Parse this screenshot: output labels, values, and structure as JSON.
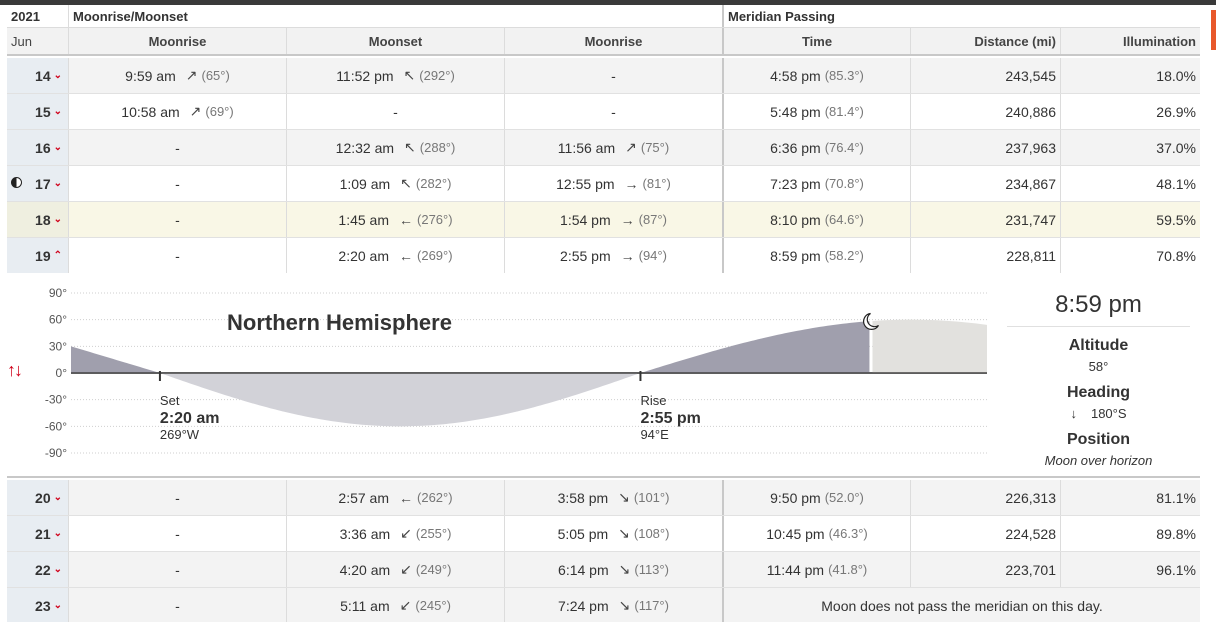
{
  "header": {
    "year": "2021",
    "group_rise_set": "Moonrise/Moonset",
    "group_meridian": "Meridian Passing",
    "month": "Jun",
    "col_moonrise_1": "Moonrise",
    "col_moonset": "Moonset",
    "col_moonrise_2": "Moonrise",
    "col_time": "Time",
    "col_distance": "Distance (mi)",
    "col_illumination": "Illumination"
  },
  "rows": [
    {
      "day": "14",
      "rise1": "9:59 am",
      "rise1_arrow": "↗",
      "rise1_deg": "(65°)",
      "set": "11:52 pm",
      "set_arrow": "↖",
      "set_deg": "(292°)",
      "rise2": "-",
      "rise2_arrow": "",
      "rise2_deg": "",
      "mer": "4:58 pm",
      "mer_deg": "(85.3°)",
      "dist": "243,545",
      "illum": "18.0%"
    },
    {
      "day": "15",
      "rise1": "10:58 am",
      "rise1_arrow": "↗",
      "rise1_deg": "(69°)",
      "set": "-",
      "set_arrow": "",
      "set_deg": "",
      "rise2": "-",
      "rise2_arrow": "",
      "rise2_deg": "",
      "mer": "5:48 pm",
      "mer_deg": "(81.4°)",
      "dist": "240,886",
      "illum": "26.9%"
    },
    {
      "day": "16",
      "rise1": "-",
      "rise1_arrow": "",
      "rise1_deg": "",
      "set": "12:32 am",
      "set_arrow": "↖",
      "set_deg": "(288°)",
      "rise2": "11:56 am",
      "rise2_arrow": "↗",
      "rise2_deg": "(75°)",
      "mer": "6:36 pm",
      "mer_deg": "(76.4°)",
      "dist": "237,963",
      "illum": "37.0%"
    },
    {
      "day": "17",
      "rise1": "-",
      "rise1_arrow": "",
      "rise1_deg": "",
      "set": "1:09 am",
      "set_arrow": "↖",
      "set_deg": "(282°)",
      "rise2": "12:55 pm",
      "rise2_arrow": "→",
      "rise2_deg": "(81°)",
      "mer": "7:23 pm",
      "mer_deg": "(70.8°)",
      "dist": "234,867",
      "illum": "48.1%"
    },
    {
      "day": "18",
      "rise1": "-",
      "rise1_arrow": "",
      "rise1_deg": "",
      "set": "1:45 am",
      "set_arrow": "←",
      "set_deg": "(276°)",
      "rise2": "1:54 pm",
      "rise2_arrow": "→",
      "rise2_deg": "(87°)",
      "mer": "8:10 pm",
      "mer_deg": "(64.6°)",
      "dist": "231,747",
      "illum": "59.5%"
    },
    {
      "day": "19",
      "rise1": "-",
      "rise1_arrow": "",
      "rise1_deg": "",
      "set": "2:20 am",
      "set_arrow": "←",
      "set_deg": "(269°)",
      "rise2": "2:55 pm",
      "rise2_arrow": "→",
      "rise2_deg": "(94°)",
      "mer": "8:59 pm",
      "mer_deg": "(58.2°)",
      "dist": "228,811",
      "illum": "70.8%"
    },
    {
      "day": "20",
      "rise1": "-",
      "rise1_arrow": "",
      "rise1_deg": "",
      "set": "2:57 am",
      "set_arrow": "←",
      "set_deg": "(262°)",
      "rise2": "3:58 pm",
      "rise2_arrow": "↘",
      "rise2_deg": "(101°)",
      "mer": "9:50 pm",
      "mer_deg": "(52.0°)",
      "dist": "226,313",
      "illum": "81.1%"
    },
    {
      "day": "21",
      "rise1": "-",
      "rise1_arrow": "",
      "rise1_deg": "",
      "set": "3:36 am",
      "set_arrow": "↙",
      "set_deg": "(255°)",
      "rise2": "5:05 pm",
      "rise2_arrow": "↘",
      "rise2_deg": "(108°)",
      "mer": "10:45 pm",
      "mer_deg": "(46.3°)",
      "dist": "224,528",
      "illum": "89.8%"
    },
    {
      "day": "22",
      "rise1": "-",
      "rise1_arrow": "",
      "rise1_deg": "",
      "set": "4:20 am",
      "set_arrow": "↙",
      "set_deg": "(249°)",
      "rise2": "6:14 pm",
      "rise2_arrow": "↘",
      "rise2_deg": "(113°)",
      "mer": "11:44 pm",
      "mer_deg": "(41.8°)",
      "dist": "223,701",
      "illum": "96.1%"
    },
    {
      "day": "23",
      "rise1": "-",
      "rise1_arrow": "",
      "rise1_deg": "",
      "set": "5:11 am",
      "set_arrow": "↙",
      "set_deg": "(245°)",
      "rise2": "7:24 pm",
      "rise2_arrow": "↘",
      "rise2_deg": "(117°)",
      "mer": "",
      "mer_deg": "",
      "dist": "",
      "illum": "",
      "note": "Moon does not pass the meridian on this day."
    }
  ],
  "detail": {
    "hemisphere": "Northern Hemisphere",
    "y_ticks": [
      "90°",
      "60°",
      "30°",
      "0°",
      "-30°",
      "-60°",
      "-90°"
    ],
    "set_label": "Set",
    "set_time": "2:20 am",
    "set_dir": "269°W",
    "rise_label": "Rise",
    "rise_time": "2:55 pm",
    "rise_dir": "94°E",
    "current_time": "8:59 pm",
    "altitude_label": "Altitude",
    "altitude_value": "58°",
    "heading_label": "Heading",
    "heading_arrow": "↓",
    "heading_value": "180°S",
    "position_label": "Position",
    "position_value": "Moon over horizon",
    "updown_icon": "↑↓"
  },
  "chart_data": {
    "type": "area",
    "title": "Northern Hemisphere",
    "ylim": [
      -90,
      90
    ],
    "y_ticks": [
      90,
      60,
      30,
      0,
      -30,
      -60,
      -90
    ],
    "x": [
      0,
      2.33,
      8.5,
      14.92,
      21,
      24
    ],
    "y": [
      30,
      0,
      -60,
      0,
      58,
      40
    ],
    "grid": true
  },
  "colors": {
    "accent": "#d0021b",
    "above_horizon": "#a09fad",
    "below_horizon": "#d2d2d8",
    "future": "#e2e1de"
  }
}
